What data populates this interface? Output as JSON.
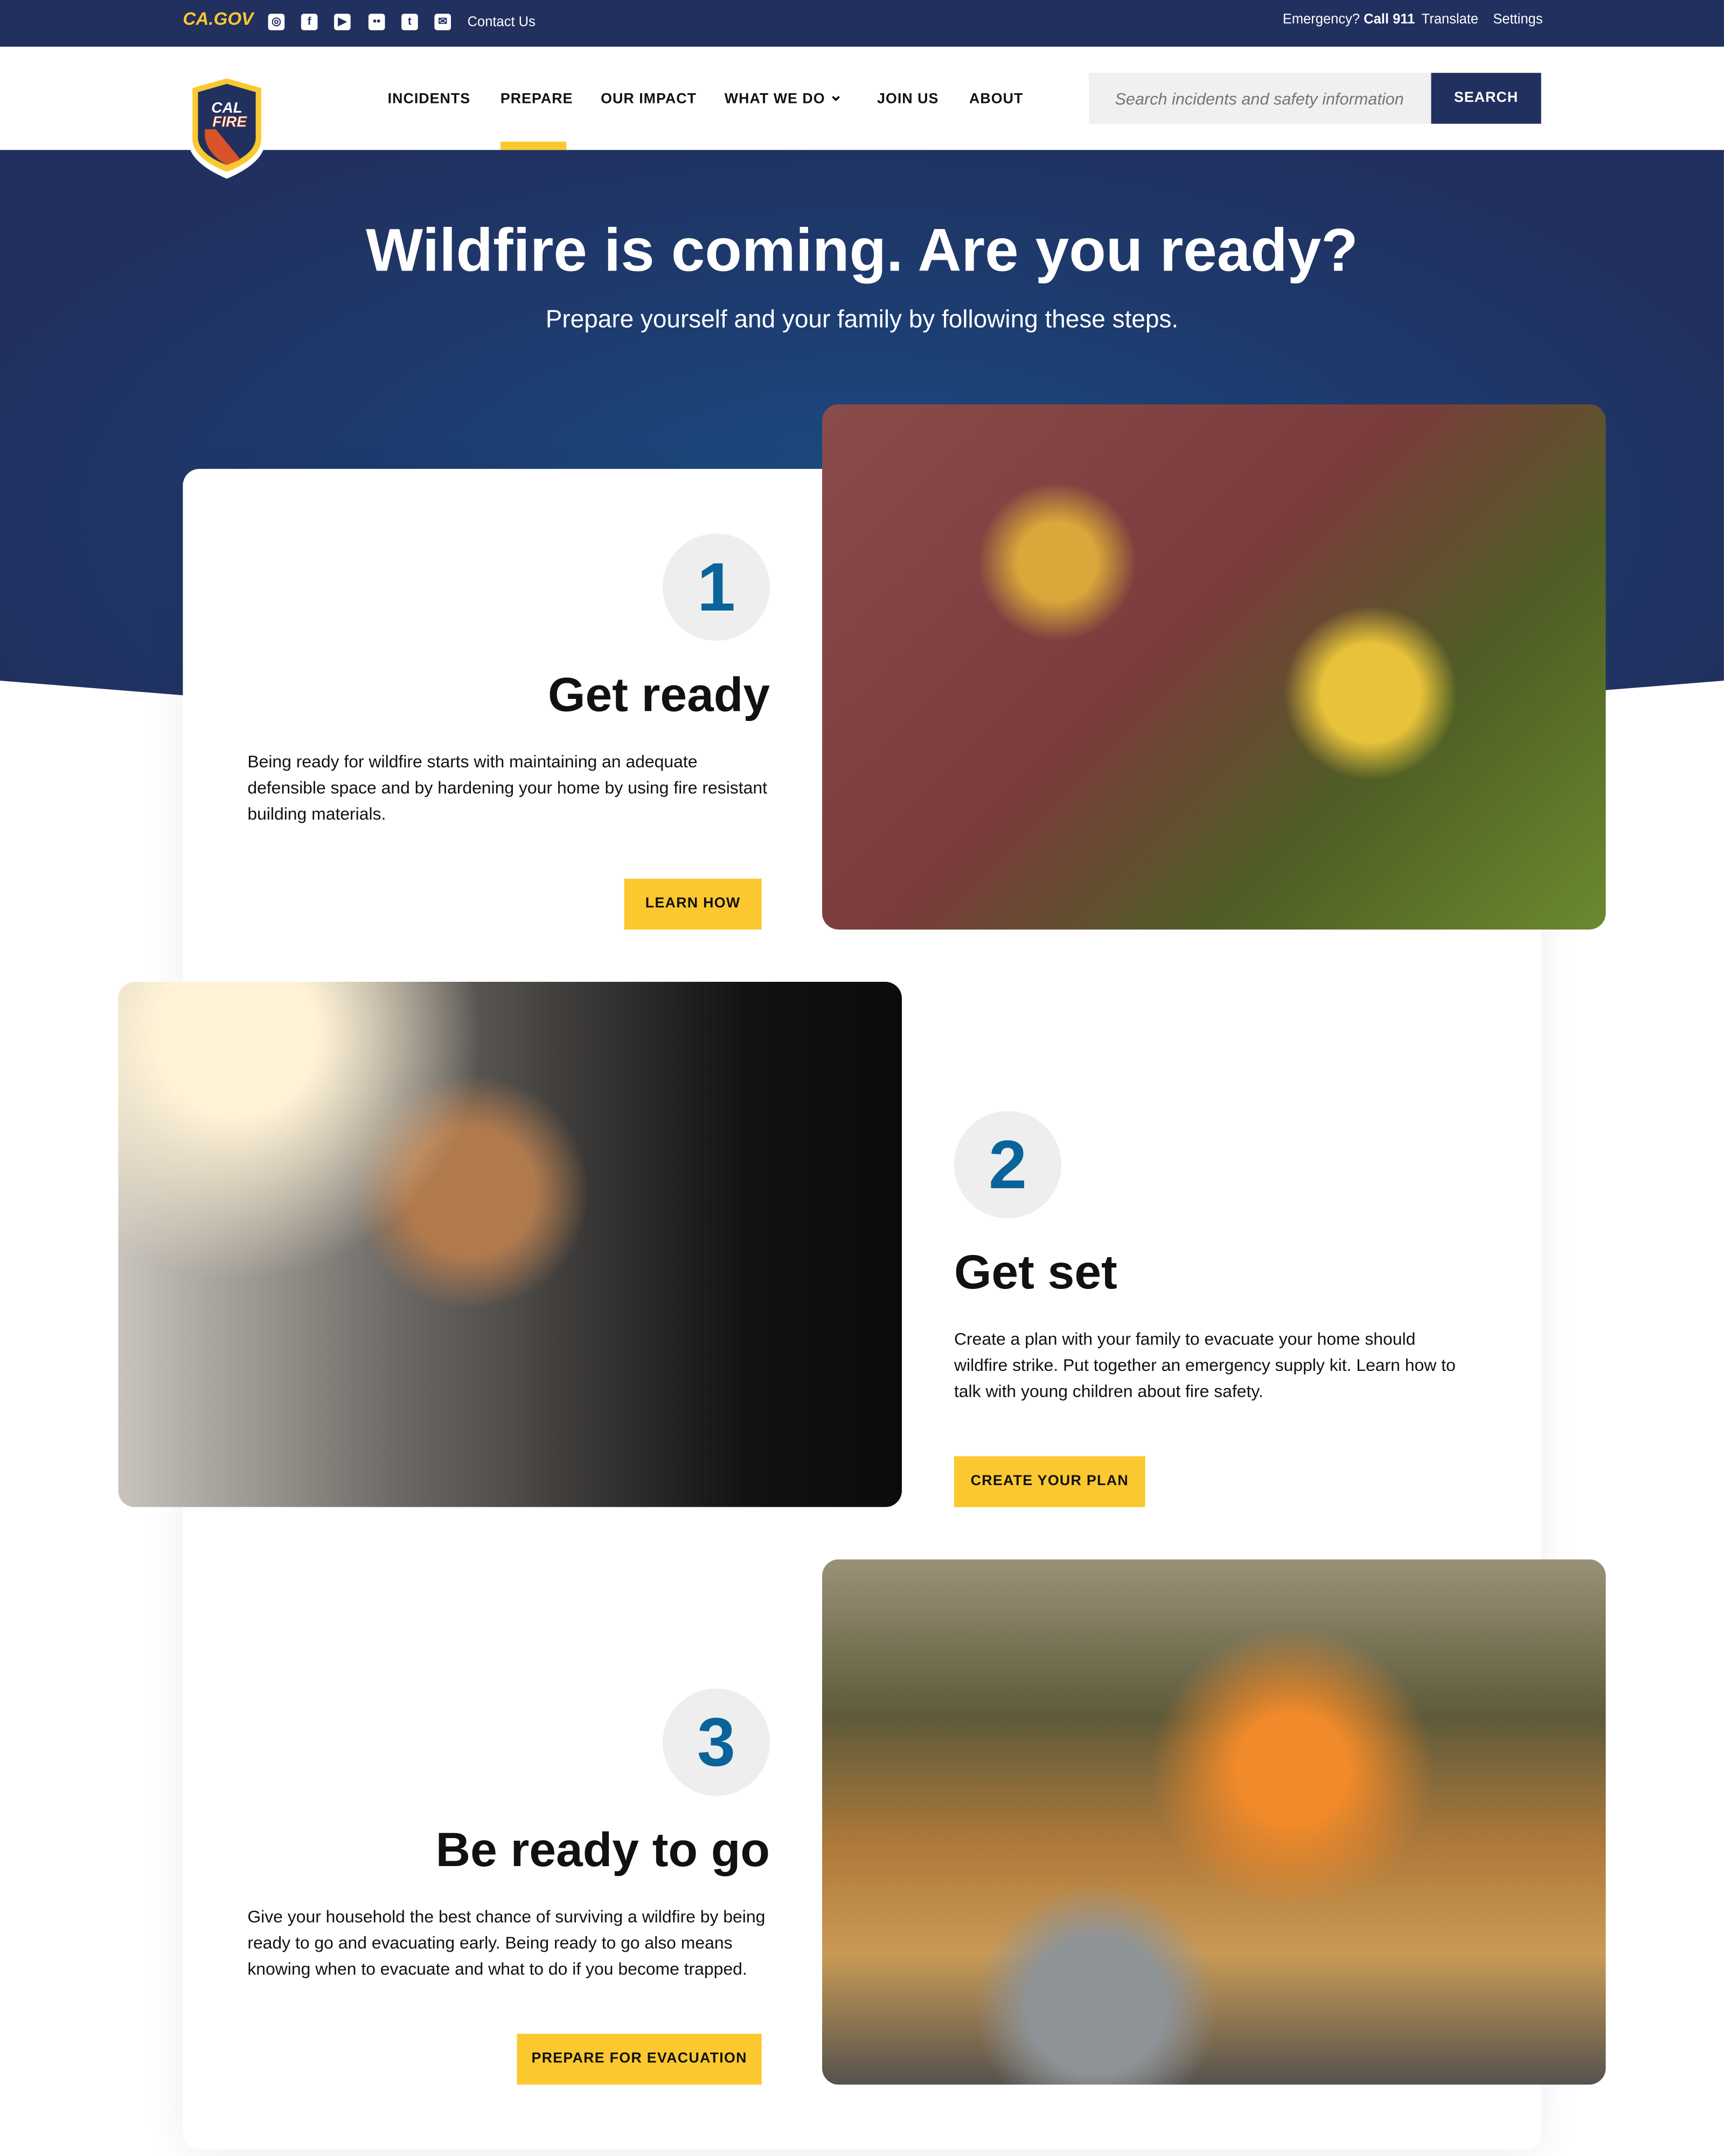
{
  "topbar": {
    "cagov_logo": "CA.GOV",
    "social_icons": [
      "instagram-icon",
      "facebook-icon",
      "youtube-icon",
      "flickr-icon",
      "twitter-icon",
      "email-icon"
    ],
    "contact": "Contact Us",
    "emergency_prefix": "Emergency?",
    "emergency_call": "Call 911",
    "translate": "Translate",
    "settings": "Settings"
  },
  "header": {
    "logo_text": "CAL FIRE",
    "nav": [
      {
        "label": "INCIDENTS"
      },
      {
        "label": "PREPARE",
        "active": true
      },
      {
        "label": "OUR IMPACT"
      },
      {
        "label": "WHAT WE DO"
      },
      {
        "label": "JOIN US"
      },
      {
        "label": "ABOUT"
      }
    ],
    "search_placeholder": "Search incidents and safety information",
    "search_button": "SEARCH"
  },
  "hero": {
    "title": "Wildfire is coming. Are you ready?",
    "subtitle": "Prepare yourself and your family by following these steps."
  },
  "steps": [
    {
      "number": "1",
      "title": "Get ready",
      "text": "Being ready for wildfire starts with maintaining an adequate defensible space and by hardening your home by using fire resistant building materials.",
      "button": "LEARN HOW"
    },
    {
      "number": "2",
      "title": "Get set",
      "text": "Create a plan with your family to evacuate your home should wildfire strike. Put together an emergency supply kit. Learn how to talk with young children about fire safety.",
      "button": "CREATE YOUR PLAN"
    },
    {
      "number": "3",
      "title": "Be ready to go",
      "text": "Give your household the best chance of surviving a wildfire by being ready to go and evacuating early. Being ready to go also means knowing when to evacuate and what to do if you become trapped.",
      "button": "PREPARE FOR EVACUATION"
    }
  ],
  "colors": {
    "navy": "#21305e",
    "accent": "#fbc830",
    "number": "#0a6399"
  }
}
